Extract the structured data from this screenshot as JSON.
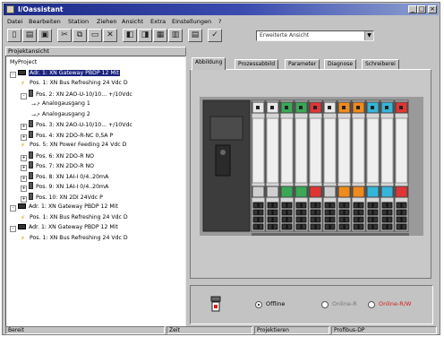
{
  "window": {
    "title": "I/Oassistant",
    "controls": [
      "_",
      "□",
      "×"
    ]
  },
  "menu": [
    "Datei",
    "Bearbeiten",
    "Station",
    "Ziehen",
    "Ansicht",
    "Extra",
    "Einstellungen",
    "?"
  ],
  "toolbar": {
    "view_select": "Erweiterte Ansicht"
  },
  "left_pane": {
    "title": "Projektansicht",
    "tree": [
      {
        "level": 0,
        "icon": "none",
        "label": "MyProject",
        "expander": ""
      },
      {
        "level": 0,
        "icon": "gateway",
        "label": "Adr. 1: XN Gateway PBDP 12 Mit",
        "expander": "-",
        "selected": true
      },
      {
        "level": 1,
        "icon": "bolt",
        "label": "Pos. 1: XN Bus Refreshing 24 Vdc D",
        "expander": ""
      },
      {
        "level": 1,
        "icon": "module",
        "label": "Pos. 2: XN 2AO-U-10/10... +/10Vdc",
        "expander": "-"
      },
      {
        "level": 2,
        "icon": "out",
        "label": "Analogausgang 1",
        "expander": ""
      },
      {
        "level": 2,
        "icon": "out",
        "label": "Analogausgang 2",
        "expander": ""
      },
      {
        "level": 1,
        "icon": "module",
        "label": "Pos. 3: XN 2AO-U-10/10... +/10Vdc",
        "expander": "+"
      },
      {
        "level": 1,
        "icon": "module",
        "label": "Pos. 4: XN 2DO-R-NC 0,5A P",
        "expander": "+"
      },
      {
        "level": 1,
        "icon": "bolt",
        "label": "Pos. 5: XN Power Feeding 24 Vdc D",
        "expander": ""
      },
      {
        "level": 1,
        "icon": "module",
        "label": "Pos. 6: XN 2DO-R NO",
        "expander": "+"
      },
      {
        "level": 1,
        "icon": "module",
        "label": "Pos. 7: XN 2DO-R NO",
        "expander": "+"
      },
      {
        "level": 1,
        "icon": "module",
        "label": "Pos. 8: XN 1AI-I 0/4..20mA",
        "expander": "+"
      },
      {
        "level": 1,
        "icon": "module",
        "label": "Pos. 9: XN 1AI-I 0/4..20mA",
        "expander": "+"
      },
      {
        "level": 1,
        "icon": "module",
        "label": "Pos. 10: XN 2DI 24Vdc P",
        "expander": "+"
      },
      {
        "level": 0,
        "icon": "gateway",
        "label": "Adr. 1: XN Gateway PBDP 12 Mit",
        "expander": "-"
      },
      {
        "level": 1,
        "icon": "bolt",
        "label": "Pos. 1: XN Bus Refreshing 24 Vdc D",
        "expander": ""
      },
      {
        "level": 0,
        "icon": "gateway",
        "label": "Adr. 1: XN Gateway PBDP 12 Mit",
        "expander": "-"
      },
      {
        "level": 1,
        "icon": "bolt",
        "label": "Pos. 1: XN Bus Refreshing 24 Vdc D",
        "expander": ""
      }
    ]
  },
  "tabs": [
    "Abbildung",
    "Prozessabbild",
    "Parameter",
    "Diagnose",
    "Schreiberei"
  ],
  "station": {
    "modules": [
      {
        "color": "#e8e8e8"
      },
      {
        "color": "#e8e8e8"
      },
      {
        "color": "#3aa857"
      },
      {
        "color": "#3aa857"
      },
      {
        "color": "#e03535"
      },
      {
        "color": "#e8e8e8"
      },
      {
        "color": "#f08a1c"
      },
      {
        "color": "#f08a1c"
      },
      {
        "color": "#35b5d8"
      },
      {
        "color": "#35b5d8"
      },
      {
        "color": "#e03535"
      }
    ]
  },
  "bottom": {
    "offline_label": "Offline",
    "online_r_label": "Online-R",
    "online_rw_label": "Online-R/W"
  },
  "status": [
    "Bereit",
    "Zeit",
    "Projektieren",
    "Profibus-DP"
  ],
  "colors": {
    "title_start": "#1c2a86",
    "selection": "#1a237e",
    "online_rw": "#d4201a"
  }
}
